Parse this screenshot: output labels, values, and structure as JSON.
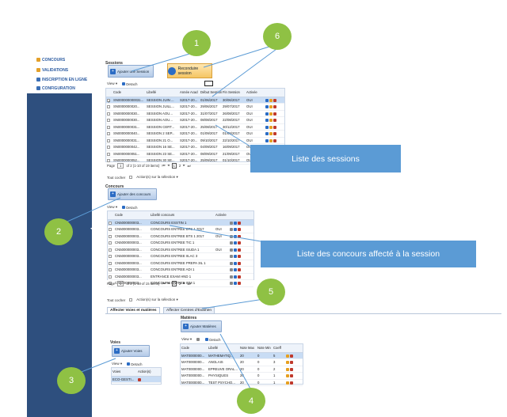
{
  "sidebar": {
    "items": [
      {
        "label": "CONCOURS",
        "icon": "user-icon",
        "color": "#e3a02a"
      },
      {
        "label": "VALIDATIONS",
        "icon": "check-icon",
        "color": "#e3a02a"
      },
      {
        "label": "INSCRIPTION EN LIGNE",
        "icon": "user-add-icon",
        "color": "#3b6fb6"
      },
      {
        "label": "CONFIGURATION",
        "icon": "gear-icon",
        "color": "#3b6fb6"
      }
    ]
  },
  "sessions": {
    "title": "Sessions",
    "add_button": "Ajouter une Session",
    "renew_button": "Reconduire session",
    "toolbar": {
      "view": "View ▾",
      "detach": "Detach"
    },
    "columns": [
      "",
      "Code",
      "Libellé",
      "Année Acad",
      "Début Session",
      "Fin Session",
      "Activée",
      ""
    ],
    "rows": [
      {
        "code": "SN000000000031...",
        "libelle": "SESSION JUIN ...",
        "annee": "S2017-20...",
        "debut": "01/06/2017",
        "fin": "30/06/2017",
        "activee": "OUI",
        "selected": true
      },
      {
        "code": "SN0000000020...",
        "libelle": "SESSION JUILL...",
        "annee": "S2017-20...",
        "debut": "29/06/2017",
        "fin": "29/07/2017",
        "activee": "OUI",
        "selected": false
      },
      {
        "code": "SN0000000030...",
        "libelle": "SESSION AOU...",
        "annee": "S2017-20...",
        "debut": "31/07/2017",
        "fin": "26/08/2017",
        "activee": "OUI",
        "selected": false
      },
      {
        "code": "SN0000000030...",
        "libelle": "SESSION AOU...",
        "annee": "S2017-20...",
        "debut": "08/08/2017",
        "fin": "22/08/2017",
        "activee": "OUI",
        "selected": false
      },
      {
        "code": "SN0000000031...",
        "libelle": "SESSION CERT...",
        "annee": "S2017-20...",
        "debut": "25/08/2017",
        "fin": "30/12/2017",
        "activee": "OUI",
        "selected": false
      },
      {
        "code": "SN0000000040...",
        "libelle": "SESSION 2 SEP...",
        "annee": "S2017-20...",
        "debut": "01/09/2017",
        "fin": "01/09/2017",
        "activee": "OUI",
        "selected": false
      },
      {
        "code": "SN0000000031...",
        "libelle": "SESSION 21 O...",
        "annee": "S2017-20...",
        "debut": "09/10/2017",
        "fin": "22/10/2017",
        "activee": "OUI",
        "selected": false
      },
      {
        "code": "SN0000000042...",
        "libelle": "SESSION 16 SE...",
        "annee": "S2017-20...",
        "debut": "04/09/2017",
        "fin": "16/09/2017",
        "activee": "OUI",
        "selected": false
      },
      {
        "code": "SN0000000051...",
        "libelle": "SESSION 23 SE...",
        "annee": "S2017-20...",
        "debut": "08/09/2017",
        "fin": "21/09/2017",
        "activee": "OUI",
        "selected": false
      },
      {
        "code": "SN0000000052...",
        "libelle": "SESSION 30 SE...",
        "annee": "S2017-20...",
        "debut": "25/09/2017",
        "fin": "01/10/2017",
        "activee": "OUI",
        "selected": false
      }
    ],
    "pager": {
      "page_label": "Page",
      "page": "1",
      "of_text": "of 2 (1-10 of 19 items)",
      "pages": [
        "1",
        "2"
      ]
    },
    "footer": {
      "check_all": "Tout cocher",
      "actions": "Action(s) sur la sélection ▾"
    }
  },
  "concours": {
    "title": "Concours",
    "add_button": "Ajouter des concours",
    "toolbar": {
      "view": "View ▾",
      "detach": "Detach"
    },
    "columns": [
      "",
      "Code",
      "Libellé concours",
      "Activée",
      ""
    ],
    "rows": [
      {
        "code": "CN5000000003...",
        "libelle": "CONCOURS ESSTIN 1",
        "activee": "",
        "selected": true
      },
      {
        "code": "CN5000000003...",
        "libelle": "CONCOURS ENTREE BTS 1 2017",
        "activee": "OUI",
        "selected": false
      },
      {
        "code": "CN5000000003...",
        "libelle": "CONCOURS ENTREE BTS 1 2017",
        "activee": "OUI",
        "selected": false
      },
      {
        "code": "CN5000000003...",
        "libelle": "CONCOURS ENTREE TIC 1",
        "activee": "",
        "selected": false
      },
      {
        "code": "CN5000000003...",
        "libelle": "CONCOURS ENTREE ISUDA 1",
        "activee": "OUI",
        "selected": false
      },
      {
        "code": "CN5000000003...",
        "libelle": "CONCOURS ENTREE IILAC 3",
        "activee": "",
        "selected": false
      },
      {
        "code": "CN5000000003...",
        "libelle": "CONCOURS ENTREE PREPA 3IL 1",
        "activee": "",
        "selected": false
      },
      {
        "code": "CN5000000003...",
        "libelle": "CONCOURS ENTREE ADI 1",
        "activee": "",
        "selected": false
      },
      {
        "code": "CN5000000003...",
        "libelle": "ENTRANCE EXAM HND 1",
        "activee": "",
        "selected": false
      },
      {
        "code": "CN5000000003...",
        "libelle": "CONCOURS ENTREE IBM 1",
        "activee": "",
        "selected": false
      }
    ],
    "pager": {
      "page_label": "Page",
      "page": "1",
      "of_text": "of 2 (1-10 of 15 items)",
      "pages": [
        "1",
        "2"
      ]
    },
    "footer": {
      "check_all": "Tout cocher",
      "actions": "Action(s) sur la sélection ▾"
    }
  },
  "tabs": [
    "Affecter Voies et matières",
    "Affecter Centres d'Examen"
  ],
  "matieres": {
    "title": "Matières",
    "add_button": "Ajouter Matières",
    "toolbar": {
      "view": "View ▾",
      "detach": "Detach"
    },
    "columns": [
      "Code",
      "Libellé",
      "Note Max",
      "Note Min",
      "Coeff",
      ""
    ],
    "rows": [
      {
        "code": "MAT0000000...",
        "libelle": "MATHEMATIQ...",
        "max": "20",
        "min": "0",
        "coeff": "5",
        "selected": true
      },
      {
        "code": "MAT0000000...",
        "libelle": "ANGLAIS",
        "max": "20",
        "min": "0",
        "coeff": "3",
        "selected": false
      },
      {
        "code": "MAT0000000...",
        "libelle": "EPREUVE ORAL...",
        "max": "20",
        "min": "0",
        "coeff": "2",
        "selected": false
      },
      {
        "code": "MAT0000000...",
        "libelle": "PHYSIQUES",
        "max": "20",
        "min": "0",
        "coeff": "1",
        "selected": false
      },
      {
        "code": "MAT0000000...",
        "libelle": "TEST PSYCHO...",
        "max": "20",
        "min": "0",
        "coeff": "1",
        "selected": false
      }
    ]
  },
  "voies": {
    "title": "Voies",
    "add_button": "Ajouter Voies",
    "toolbar": {
      "view": "View ▾",
      "detach": "Detach"
    },
    "columns": [
      "Voies",
      "Action(s)"
    ],
    "rows": [
      {
        "voie": "ECO-GESTI...",
        "selected": true
      }
    ]
  },
  "annotations": {
    "callouts": [
      "1",
      "2",
      "3",
      "4",
      "5",
      "6"
    ],
    "boxes": [
      "Liste des sessions",
      "Liste des concours affecté à la session"
    ],
    "callout_color": "#8fc144",
    "box_color": "#5b9bd5"
  }
}
